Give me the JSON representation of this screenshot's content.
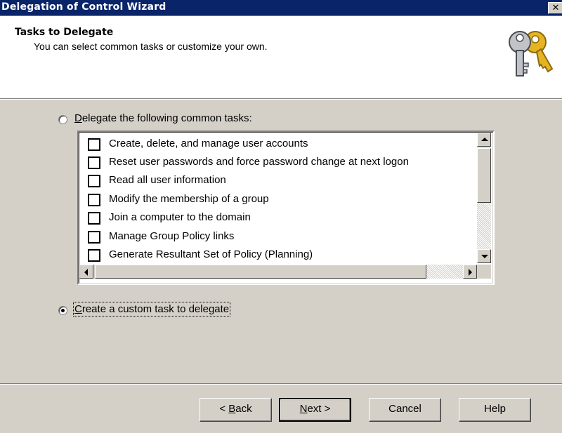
{
  "window": {
    "title": "Delegation of Control Wizard",
    "close_glyph": "✕"
  },
  "header": {
    "title": "Tasks to Delegate",
    "subtitle": "You can select common tasks or customize your own.",
    "icon": "keys-icon"
  },
  "options": {
    "common": {
      "label": "Delegate the following common tasks:",
      "mnemonic": "D",
      "selected": false
    },
    "custom": {
      "label": "Create a custom task to delegate",
      "mnemonic": "C",
      "selected": true
    }
  },
  "tasks": [
    {
      "label": "Create, delete, and manage user accounts",
      "checked": false
    },
    {
      "label": "Reset user passwords and force password change at next logon",
      "checked": false
    },
    {
      "label": "Read all user information",
      "checked": false
    },
    {
      "label": "Modify the membership of a group",
      "checked": false
    },
    {
      "label": "Join a computer to the domain",
      "checked": false
    },
    {
      "label": "Manage Group Policy links",
      "checked": false
    },
    {
      "label": "Generate Resultant Set of Policy (Planning)",
      "checked": false
    }
  ],
  "buttons": {
    "back": {
      "label": "< Back",
      "mnemonic": "B"
    },
    "next": {
      "label": "Next >",
      "mnemonic": "N"
    },
    "cancel": {
      "label": "Cancel"
    },
    "help": {
      "label": "Help"
    }
  },
  "colors": {
    "titlebar": "#0a246a",
    "dialog_face": "#d4d0c8",
    "header_bg": "#ffffff"
  }
}
